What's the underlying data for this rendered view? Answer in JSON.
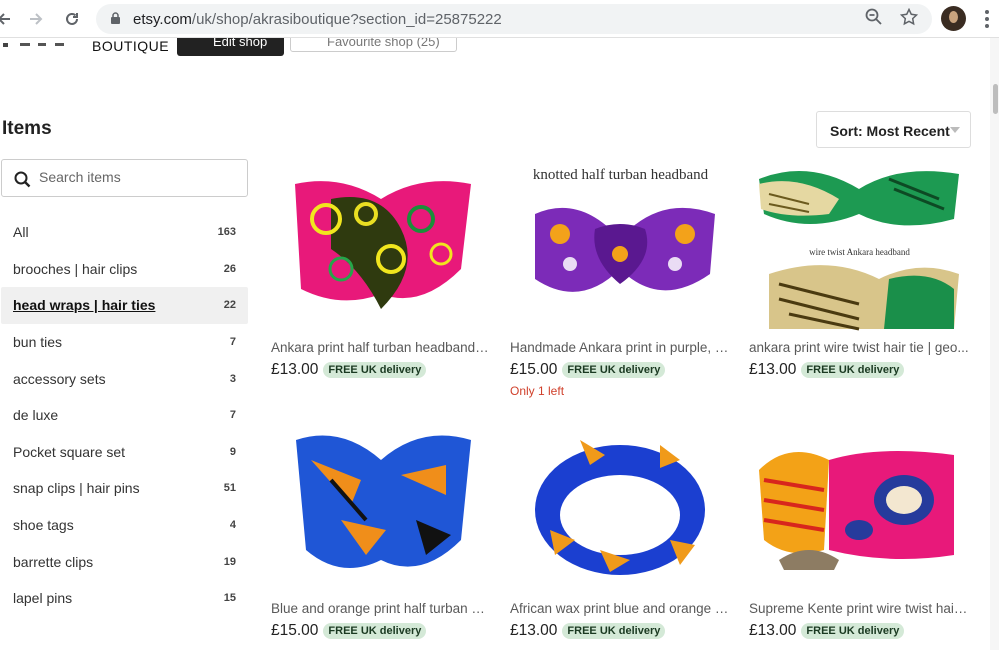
{
  "browser": {
    "url_host": "etsy.com",
    "url_path": "/uk/shop/akrasiboutique?section_id=25875222"
  },
  "shop": {
    "logo_text": "BOUTIQUE",
    "edit_shop_label": "Edit shop",
    "favourite_label": "Favourite shop (25)"
  },
  "items": {
    "title": "Items",
    "sort_label": "Sort: Most Recent"
  },
  "search": {
    "placeholder": "Search items"
  },
  "categories": [
    {
      "label": "All",
      "count": "163"
    },
    {
      "label": "brooches | hair clips",
      "count": "26"
    },
    {
      "label": "head wraps | hair ties",
      "count": "22",
      "active": true
    },
    {
      "label": "bun ties",
      "count": "7"
    },
    {
      "label": "accessory sets",
      "count": "3"
    },
    {
      "label": "de luxe",
      "count": "7"
    },
    {
      "label": "Pocket square set",
      "count": "9"
    },
    {
      "label": "snap clips | hair pins",
      "count": "51"
    },
    {
      "label": "shoe tags",
      "count": "4"
    },
    {
      "label": "barrette clips",
      "count": "19"
    },
    {
      "label": "lapel pins",
      "count": "15"
    }
  ],
  "listings": [
    {
      "title": "Ankara print half turban headband | ...",
      "price": "£13.00",
      "badge": "FREE UK delivery",
      "stock": ""
    },
    {
      "title": "Handmade Ankara print in purple, cr...",
      "price": "£15.00",
      "badge": "FREE UK delivery",
      "stock": "Only 1 left",
      "caption": "knotted half turban headband"
    },
    {
      "title": "ankara print wire twist hair tie | geo...",
      "price": "£13.00",
      "badge": "FREE UK delivery",
      "stock": "",
      "caption": "wire twist Ankara headband"
    },
    {
      "title": "Blue and orange print half turban he...",
      "price": "£15.00",
      "badge": "FREE UK delivery",
      "stock": ""
    },
    {
      "title": "African wax print blue and orange wi...",
      "price": "£13.00",
      "badge": "FREE UK delivery",
      "stock": ""
    },
    {
      "title": "Supreme Kente print wire twist hair ti...",
      "price": "£13.00",
      "badge": "FREE UK delivery",
      "stock": ""
    }
  ],
  "colors": {
    "badge_bg": "#d4e9d7",
    "stock_red": "#d0402b",
    "edit_button": "#222222"
  }
}
